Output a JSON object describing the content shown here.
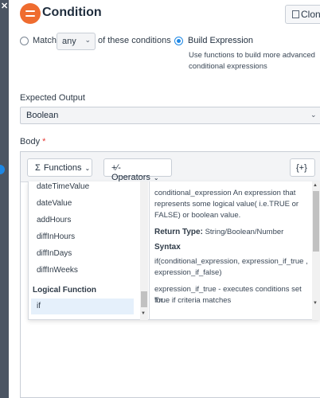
{
  "header": {
    "title": "Condition",
    "clone_label": "Clon"
  },
  "match": {
    "label": "Match",
    "value": "any",
    "suffix": "of these conditions"
  },
  "build_expression": {
    "label": "Build Expression",
    "desc_line1": "Use functions to build more advanced",
    "desc_line2": "conditional expressions"
  },
  "expected_output": {
    "label": "Expected Output",
    "value": "Boolean"
  },
  "body": {
    "label": "Body",
    "required_mark": "*"
  },
  "toolbar": {
    "functions_symbol": "Σ",
    "functions_label": "Functions",
    "operators_symbol": "+∕-",
    "operators_label": "Operators",
    "vars_label": "{+}"
  },
  "functions": {
    "items": [
      "dateTimeValue",
      "dateValue",
      "addHours",
      "diffInHours",
      "diffInDays",
      "diffInWeeks"
    ],
    "group_label": "Logical Function",
    "selected": "if"
  },
  "doc": {
    "line1": "conditional_expression An expression that",
    "line2": "represents some logical value( i.e.TRUE or",
    "line3": "FALSE) or boolean value.",
    "return_label": "Return Type:",
    "return_value": "String/Boolean/Number",
    "syntax_label": "Syntax",
    "syntax_line1": "if(conditional_expression, expression_if_true ,",
    "syntax_line2": "expression_if_false)",
    "desc_line1": "expression_if_true - executes conditions set for",
    "desc_line2": "True if criteria matches"
  },
  "colors": {
    "accent": "#1e88e5",
    "condition_icon": "#ef6c2f",
    "required": "#e53935"
  }
}
